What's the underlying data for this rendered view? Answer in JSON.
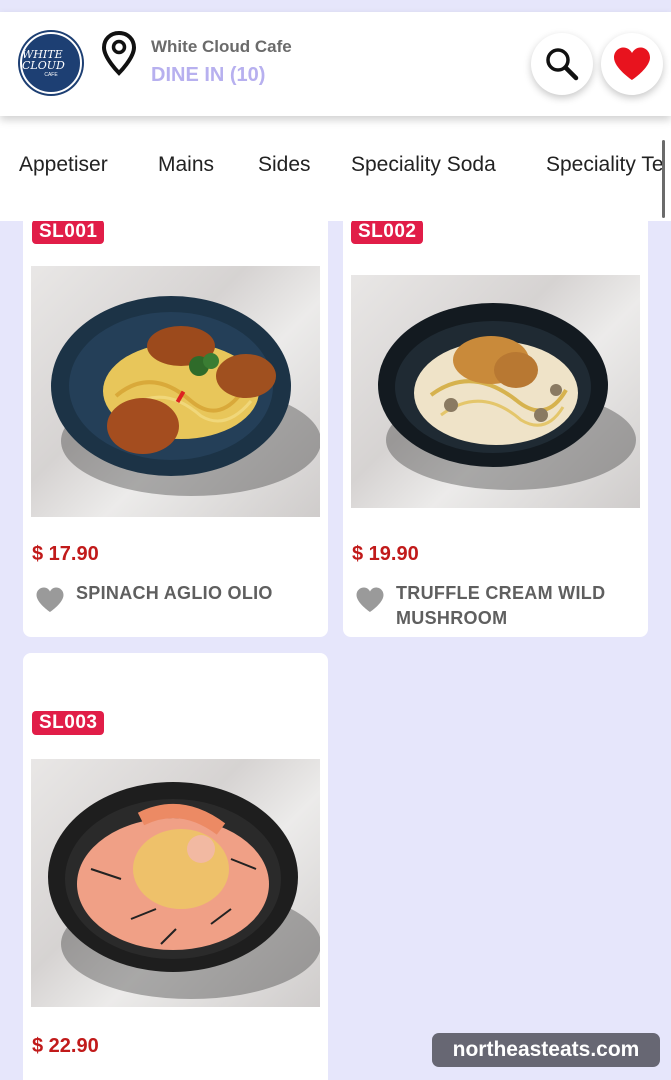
{
  "header": {
    "logo_text": "WHITE CLOUD",
    "logo_sub": "CAFE",
    "cafe_name": "White Cloud Cafe",
    "dine_in": "DINE IN (10)"
  },
  "tabs": [
    "Appetiser",
    "Mains",
    "Sides",
    "Speciality Soda",
    "Speciality Te"
  ],
  "items": [
    {
      "code": "SL001",
      "price": "$ 17.90",
      "name_line1": "SPINACH AGLIO OLIO",
      "name_line2": ""
    },
    {
      "code": "SL002",
      "price": "$ 19.90",
      "name_line1": "TRUFFLE CREAM WILD",
      "name_line2": "MUSHROOM"
    },
    {
      "code": "SL003",
      "price": "$ 22.90",
      "name_line1": "",
      "name_line2": ""
    }
  ],
  "watermark": "northeasteats.com",
  "colors": {
    "background": "#e6e6fb",
    "badge": "#e11d48",
    "price": "#c11a1a",
    "dine_in": "#b7b0ef",
    "favorite": "#e8131e"
  }
}
